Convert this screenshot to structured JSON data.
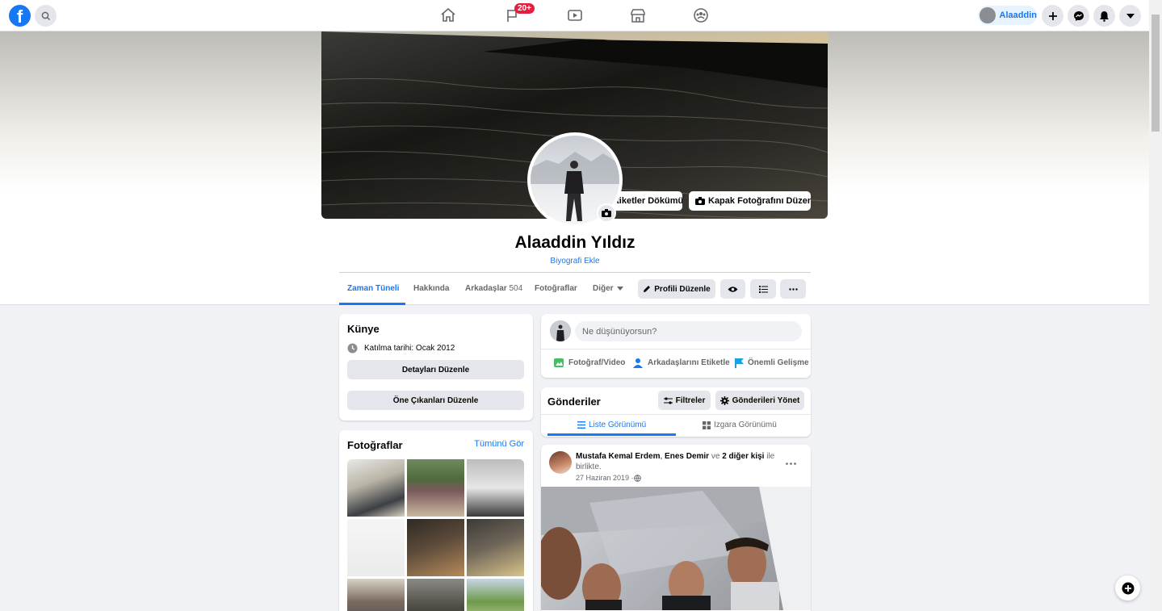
{
  "topbar": {
    "logo_letter": "f",
    "notifications_badge": "20+",
    "user_name": "Alaaddin"
  },
  "cover": {
    "memories_button": "Anı Etiketler Dökümü",
    "edit_cover_button": "Kapak Fotoğrafını Düzenle"
  },
  "profile": {
    "name": "Alaaddin Yıldız",
    "bio_link": "Biyografi Ekle"
  },
  "tabs": {
    "timeline": "Zaman Tüneli",
    "about": "Hakkında",
    "friends": "Arkadaşlar",
    "friends_count": "504",
    "photos": "Fotoğraflar",
    "more": "Diğer",
    "edit_profile": "Profili Düzenle"
  },
  "intro": {
    "title": "Künye",
    "joined": "Katılma tarihi: Ocak 2012",
    "edit_details": "Detayları Düzenle",
    "edit_featured": "Öne Çıkanları Düzenle"
  },
  "photos": {
    "title": "Fotoğraflar",
    "see_all": "Tümünü Gör"
  },
  "composer": {
    "placeholder": "Ne düşünüyorsun?",
    "photo_video": "Fotoğraf/Video",
    "tag_friends": "Arkadaşlarını Etiketle",
    "life_event": "Önemli Gelişme"
  },
  "posts_header": {
    "title": "Gönderiler",
    "filters": "Filtreler",
    "manage": "Gönderileri Yönet",
    "list_view": "Liste Görünümü",
    "grid_view": "Izgara Görünümü"
  },
  "post": {
    "author1": "Mustafa Kemal Erdem",
    "sep": ", ",
    "author2": "Enes Demir",
    "conj": " ve ",
    "others": "2 diğer kişi",
    "tail": " ile birlikte.",
    "date": "27 Haziran 2019 · "
  },
  "colors": {
    "accent": "#1877f2",
    "badge": "#e41e3f",
    "background": "#f0f2f5"
  }
}
